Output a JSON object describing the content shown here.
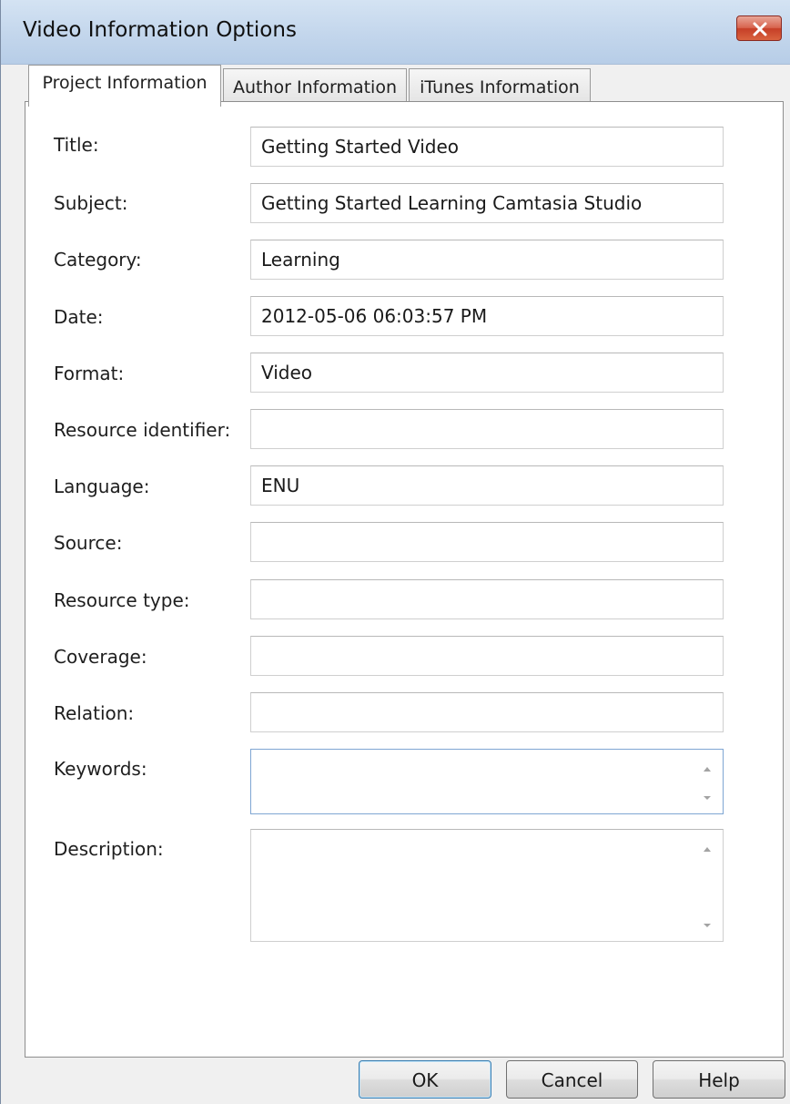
{
  "dialog": {
    "title": "Video Information Options"
  },
  "tabs": [
    {
      "label": "Project Information",
      "active": true
    },
    {
      "label": "Author Information",
      "active": false
    },
    {
      "label": "iTunes Information",
      "active": false
    }
  ],
  "fields": {
    "title": {
      "label": "Title:",
      "value": "Getting Started Video"
    },
    "subject": {
      "label": "Subject:",
      "value": "Getting Started Learning Camtasia Studio"
    },
    "category": {
      "label": "Category:",
      "value": "Learning"
    },
    "date": {
      "label": "Date:",
      "value": "2012-05-06 06:03:57 PM"
    },
    "format": {
      "label": "Format:",
      "value": "Video"
    },
    "resource_identifier": {
      "label": "Resource identifier:",
      "value": ""
    },
    "language": {
      "label": "Language:",
      "value": "ENU"
    },
    "source": {
      "label": "Source:",
      "value": ""
    },
    "resource_type": {
      "label": "Resource type:",
      "value": ""
    },
    "coverage": {
      "label": "Coverage:",
      "value": ""
    },
    "relation": {
      "label": "Relation:",
      "value": ""
    },
    "keywords": {
      "label": "Keywords:",
      "value": ""
    },
    "description": {
      "label": "Description:",
      "value": ""
    }
  },
  "buttons": {
    "ok": "OK",
    "cancel": "Cancel",
    "help": "Help"
  },
  "icons": {
    "close": "close-icon",
    "scroll_up": "scroll-up-arrow-icon",
    "scroll_down": "scroll-down-arrow-icon"
  },
  "colors": {
    "titlebar": "#c3d6ec",
    "close_button": "#c63f27",
    "default_button_border": "#3c7fb1"
  }
}
